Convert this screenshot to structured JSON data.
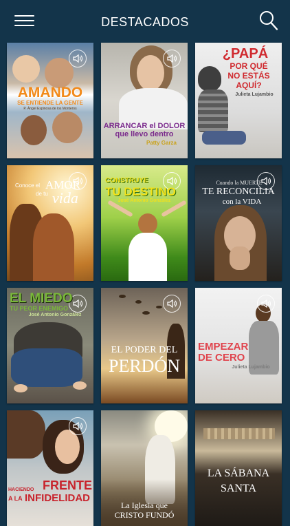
{
  "header": {
    "title": "DESTACADOS",
    "menu_icon": "hamburger-menu-icon",
    "search_icon": "search-icon"
  },
  "books": [
    {
      "id": "amando",
      "line1": "AMANDO",
      "line2": "SE ENTIENDE LA GENTE",
      "author": "P. Ángel Espinosa de los Monteros"
    },
    {
      "id": "arrancar",
      "line1": "ARRANCAR el DOLOR",
      "line2": "que llevo dentro",
      "author": "Patty Garza"
    },
    {
      "id": "papa",
      "line1": "¿PAPÁ",
      "line2": "POR QUÉ",
      "line3": "NO ESTÁS",
      "line4": "AQUÍ?",
      "author": "Julieta Lujambio"
    },
    {
      "id": "amor",
      "pre": "Conoce el",
      "line1": "AMOR",
      "mid": "de tu",
      "line2": "vida"
    },
    {
      "id": "destino",
      "line1": "CONSTRUYE",
      "line2": "TU DESTINO",
      "author": "José Antonio González"
    },
    {
      "id": "muerte",
      "line1": "Cuando la MUERTE",
      "line2": "TE RECONCILIA",
      "line3": "con la VIDA"
    },
    {
      "id": "miedo",
      "line1": "EL MIEDO",
      "line2": "TU PEOR ENEMIGO",
      "author": "José Antonio González"
    },
    {
      "id": "perdon",
      "line1": "EL PODER DEL",
      "line2": "PERDÓN"
    },
    {
      "id": "cero",
      "line1": "EMPEZAR",
      "line2": "DE CERO",
      "author": "Julieta Lujambio"
    },
    {
      "id": "frente",
      "line1": "HACIENDO",
      "line2": "FRENTE",
      "line3": "A LA",
      "line4": "INFIDELIDAD"
    },
    {
      "id": "iglesia",
      "line1": "La Iglesia que",
      "line2": "CRISTO FUNDÓ"
    },
    {
      "id": "sabana",
      "line1": "LA SÁBANA",
      "line2": "SANTA"
    }
  ],
  "colors": {
    "background": "#13344a",
    "amando_orange": "#f28a1a",
    "arrancar_purple": "#7a2a8c",
    "papa_red": "#d02a2f",
    "destino_yellow": "#f2e11a",
    "miedo_green": "#7ab83a",
    "cero_red": "#e0434c",
    "frente_red": "#c8232c"
  },
  "audio_icon": "speaker-icon"
}
